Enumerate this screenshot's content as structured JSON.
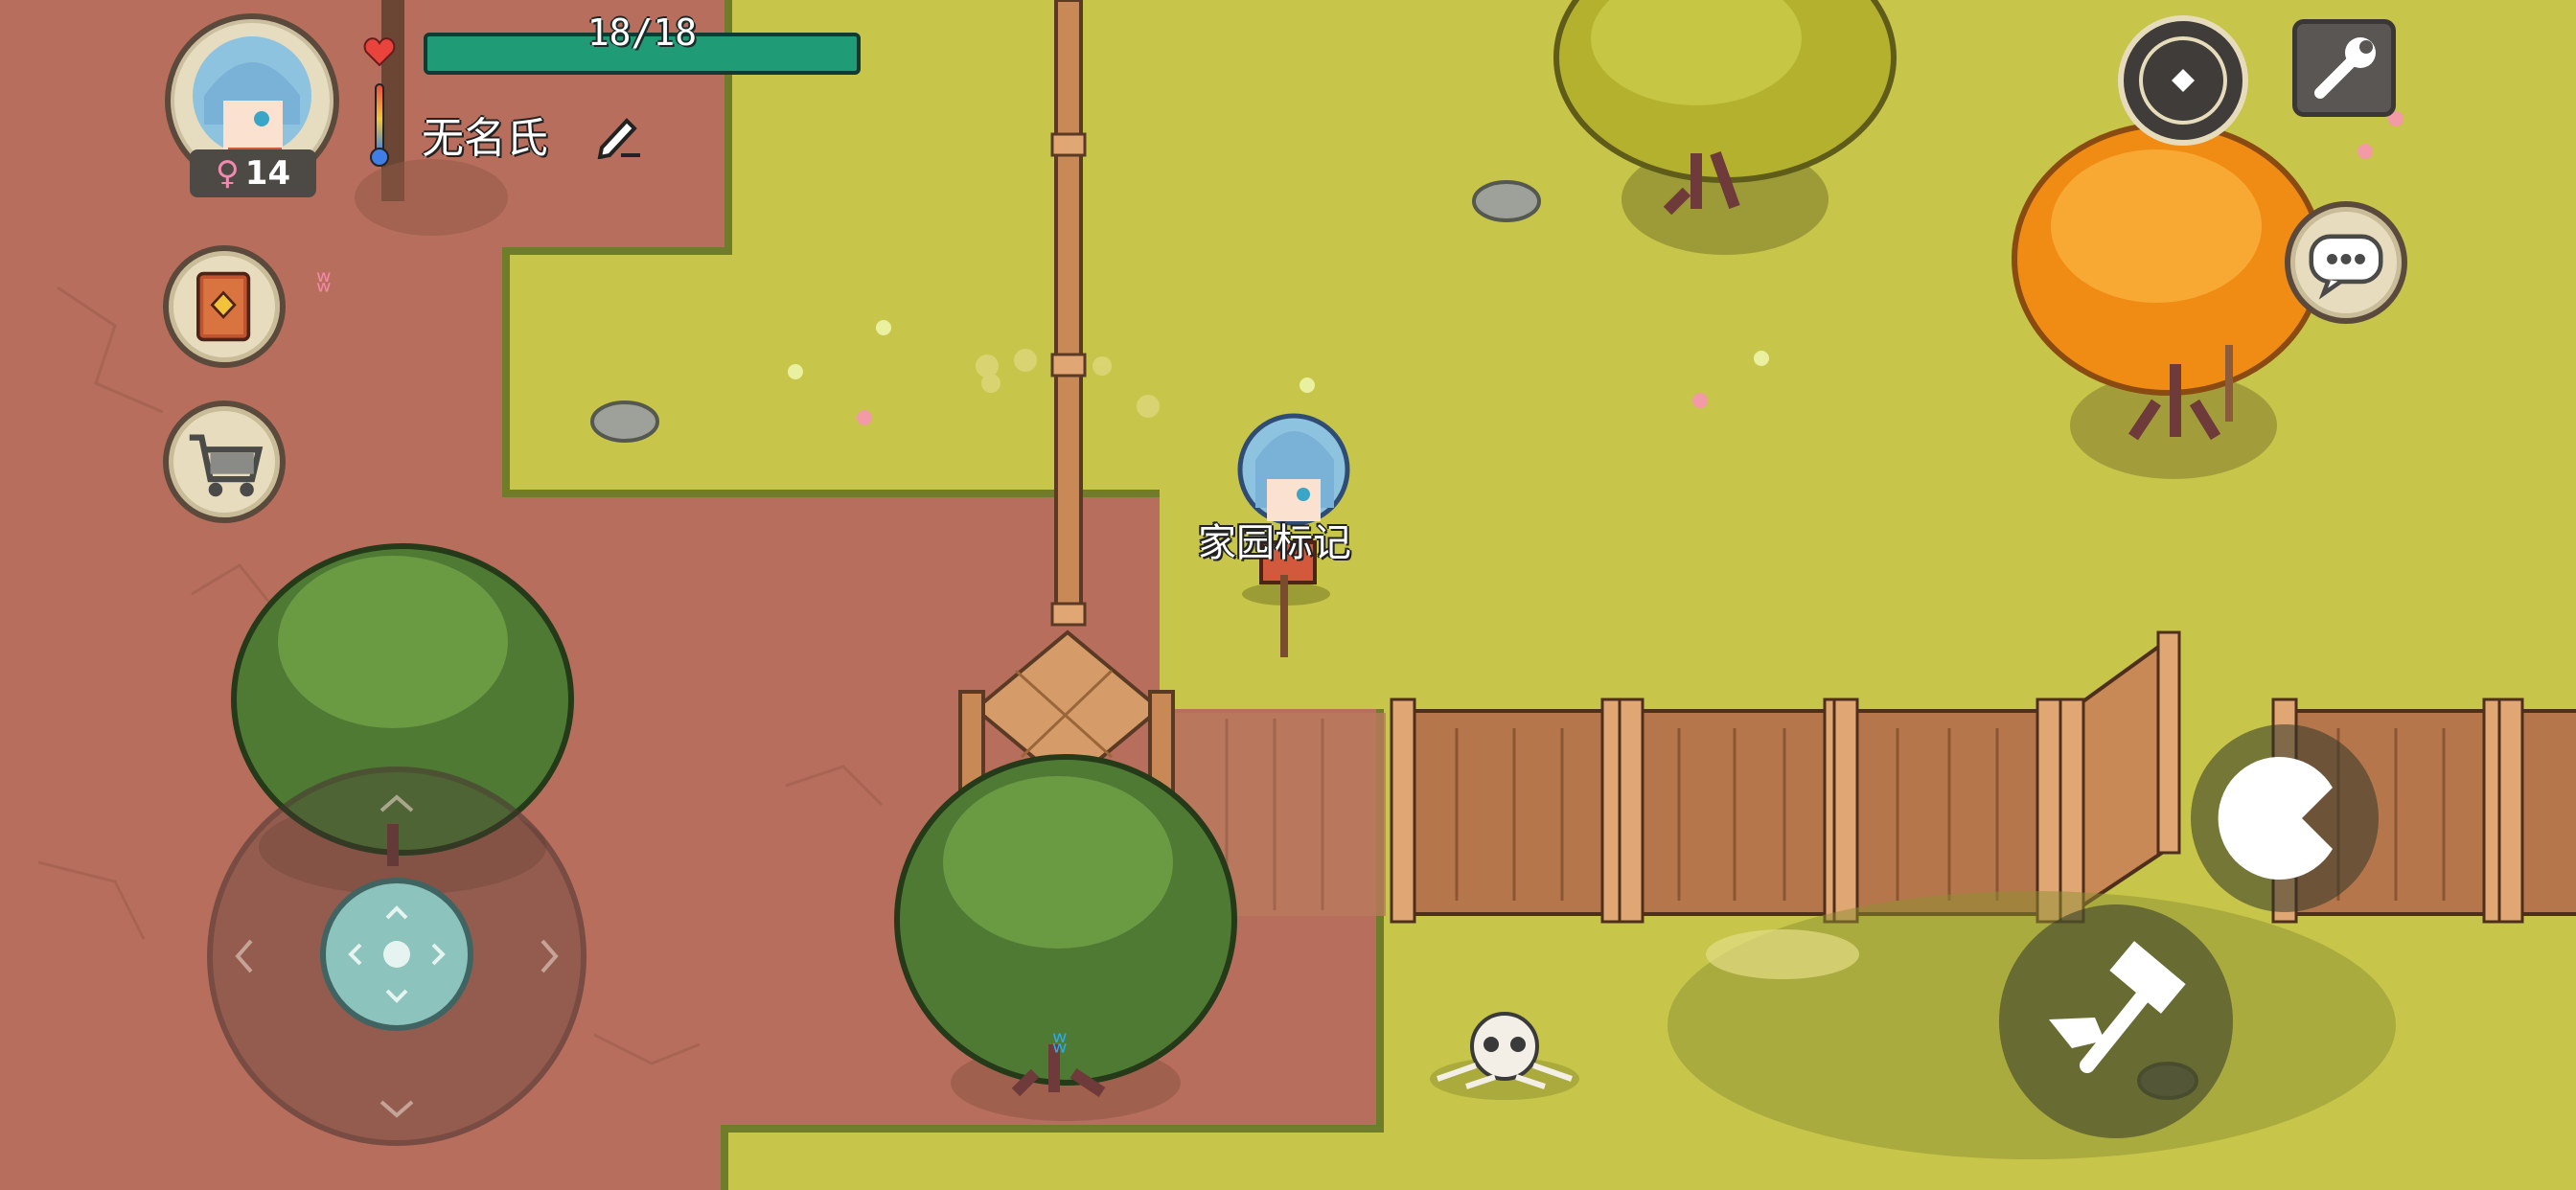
{
  "hud": {
    "hp_text": "18/18",
    "hp_fraction": 1.0,
    "player_name": "无名氏",
    "level": "14",
    "gender_symbol": "♀"
  },
  "world": {
    "home_marker_label": "家园标记"
  },
  "icons": {
    "heart": "heart-icon",
    "thermometer": "thermometer-icon",
    "edit": "pencil-edit-icon",
    "journal": "journal-book-icon",
    "shop": "shopping-cart-icon",
    "compass": "compass-icon",
    "settings": "wrench-icon",
    "chat": "chat-bubble-icon",
    "interact": "pacman-interact-icon",
    "attack": "hammer-axe-icon",
    "joystick": "joystick-icon"
  },
  "colors": {
    "hp_bar": "#1f9b75",
    "grass": "#c7c64a",
    "dirt": "#b86e5c",
    "fence": "#b5764b",
    "autumn_tree": "#f3961f"
  }
}
